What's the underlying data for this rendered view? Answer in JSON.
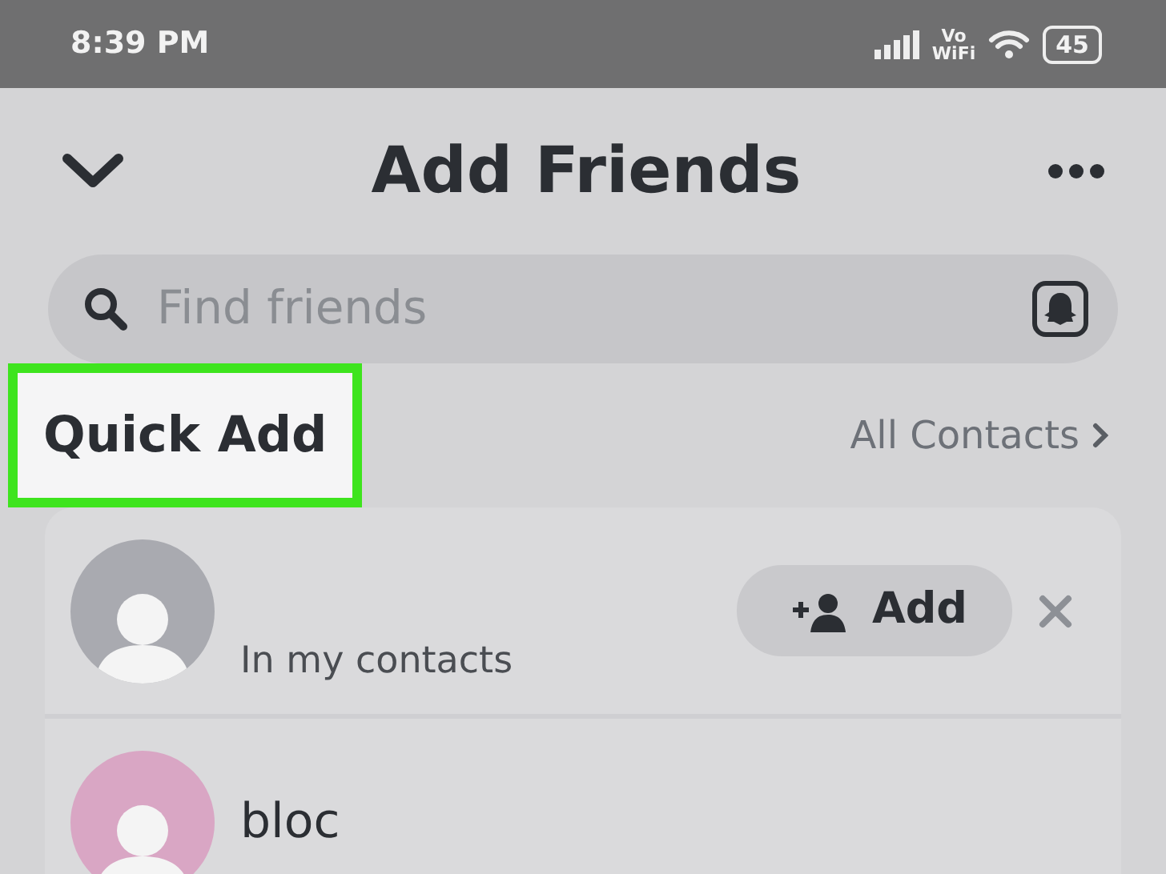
{
  "status_bar": {
    "time": "8:39 PM",
    "network_label": "Vo\nWiFi",
    "battery": "45"
  },
  "header": {
    "title": "Add Friends"
  },
  "search": {
    "placeholder": "Find friends"
  },
  "section": {
    "title": "Quick Add",
    "highlighted": true,
    "link": "All Contacts"
  },
  "friends": [
    {
      "subtitle": "In my contacts",
      "color": "#a9aab0",
      "button": "Add"
    },
    {
      "name": "bloc",
      "color": "#d9a6c4"
    }
  ]
}
